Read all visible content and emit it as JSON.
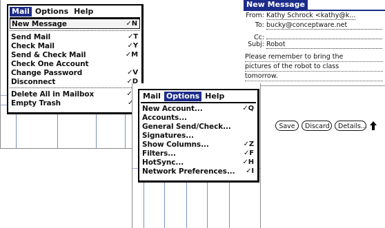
{
  "mail_menu_screen": {
    "menubar": {
      "mail": "Mail",
      "options": "Options",
      "help": "Help"
    },
    "items": [
      {
        "label": "New Message",
        "shortcut": "✓N"
      },
      {
        "label": "Send Mail",
        "shortcut": "✓T"
      },
      {
        "label": "Check Mail",
        "shortcut": "✓Y"
      },
      {
        "label": "Send & Check Mail",
        "shortcut": "✓M"
      },
      {
        "label": "Check One Account",
        "shortcut": ""
      },
      {
        "label": "Change Password",
        "shortcut": "✓V"
      },
      {
        "label": "Disconnect",
        "shortcut": "✓D"
      },
      {
        "label": "Delete All in Mailbox",
        "shortcut": "✓O"
      },
      {
        "label": "Empty Trash",
        "shortcut": "✓E"
      }
    ]
  },
  "options_menu_screen": {
    "menubar": {
      "mail": "Mail",
      "options": "Options",
      "help": "Help"
    },
    "items": [
      {
        "label": "New Account...",
        "shortcut": "✓Q"
      },
      {
        "label": "Accounts...",
        "shortcut": ""
      },
      {
        "label": "General Send/Check...",
        "shortcut": ""
      },
      {
        "label": "Signatures...",
        "shortcut": ""
      },
      {
        "label": "Show Columns...",
        "shortcut": "✓Z"
      },
      {
        "label": "Filters...",
        "shortcut": "✓F"
      },
      {
        "label": "HotSync...",
        "shortcut": "✓H"
      },
      {
        "label": "Network Preferences...",
        "shortcut": "✓I"
      }
    ]
  },
  "new_message_screen": {
    "title": "New Message",
    "from_label": "From:",
    "from_value": "Kathy Schrock <kathy@k...",
    "to_label": "To:",
    "to_value": "bucky@conceptware.net",
    "cc_label": "Cc:",
    "cc_value": "",
    "subj_label": "Subj:",
    "subj_value": "Robot",
    "body_lines": [
      "Please remember to bring the",
      "pictures of the robot to class",
      "tomorrow."
    ],
    "buttons": {
      "save": "Save",
      "discard": "Discard",
      "details": "Details..."
    }
  },
  "colors": {
    "highlight": "#1c2c8a",
    "grid": "#7a8fbf"
  }
}
